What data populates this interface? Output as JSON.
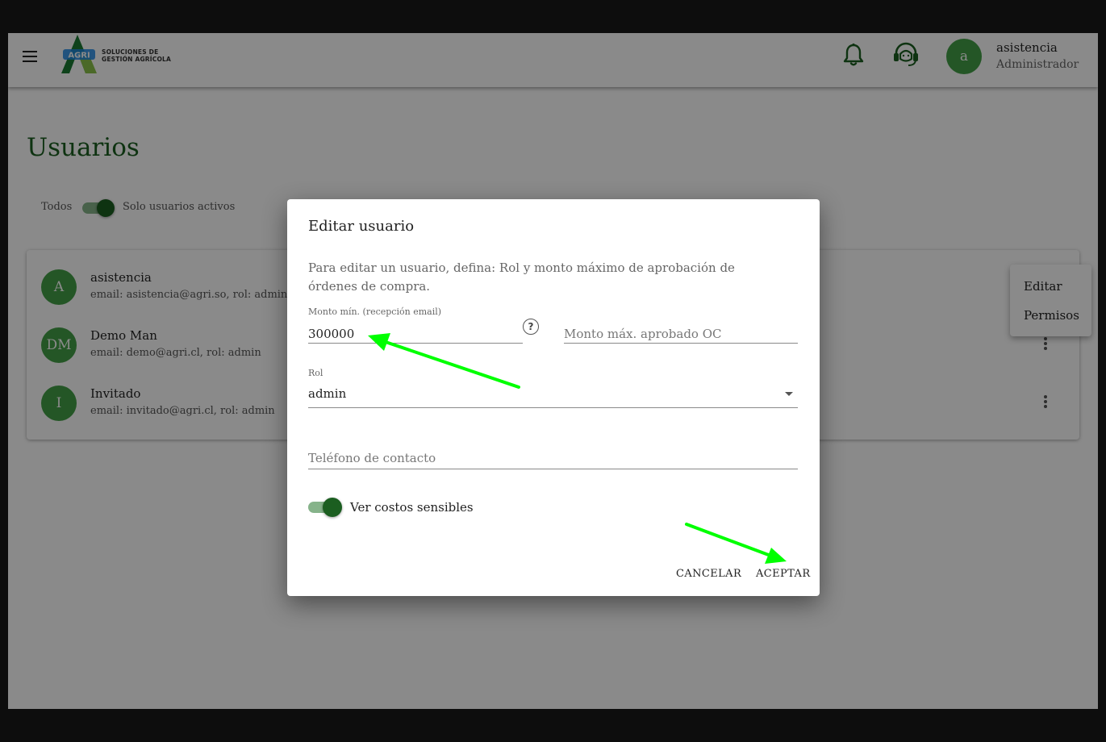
{
  "header": {
    "logo_mark": "AGRI",
    "logo_line1": "SOLUCIONES DE",
    "logo_line2": "GESTIÓN AGRÍCOLA",
    "user_avatar": "a",
    "user_name": "asistencia",
    "user_role": "Administrador"
  },
  "page": {
    "title": "Usuarios",
    "filter_all_label": "Todos",
    "filter_active_label": "Solo usuarios activos"
  },
  "users": [
    {
      "initials": "A",
      "name": "asistencia",
      "email": "email: asistencia@agri.so, rol: admin"
    },
    {
      "initials": "DM",
      "name": "Demo Man",
      "email": "email: demo@agri.cl, rol: admin"
    },
    {
      "initials": "I",
      "name": "Invitado",
      "email": "email: invitado@agri.cl, rol: admin"
    }
  ],
  "context_menu": {
    "edit": "Editar",
    "permissions": "Permisos"
  },
  "dialog": {
    "title": "Editar usuario",
    "description": "Para editar un usuario, defina: Rol y monto máximo de aprobación de órdenes de compra.",
    "min_amount_label": "Monto mín. (recepción email)",
    "min_amount_value": "300000",
    "max_amount_placeholder": "Monto máx. aprobado OC",
    "role_label": "Rol",
    "role_value": "admin",
    "phone_placeholder": "Teléfono de contacto",
    "sensitive_costs_label": "Ver costos sensibles",
    "cancel_label": "CANCELAR",
    "accept_label": "ACEPTAR"
  },
  "colors": {
    "brand_green": "#1b5e20",
    "avatar_green": "#43a047",
    "annotation_arrow": "#00ff00"
  }
}
